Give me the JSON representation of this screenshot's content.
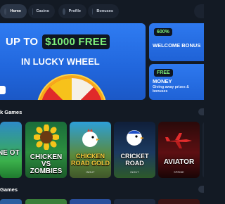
{
  "nav": {
    "items": [
      {
        "label": "Home",
        "icon": "home-icon",
        "active": true
      },
      {
        "label": "Casino",
        "icon": "casino-chip-icon",
        "active": false
      },
      {
        "label": "Profile",
        "icon": "profile-icon",
        "active": false
      },
      {
        "label": "Bonuses",
        "icon": "gift-icon",
        "active": false
      }
    ]
  },
  "hero": {
    "line1_prefix": "UP TO",
    "amount": "$1000 FREE",
    "line2": "IN LUCKY WHEEL"
  },
  "promos": {
    "welcome": {
      "badge": "600%",
      "title": "WELCOME BONUS"
    },
    "free": {
      "badge": "FREE",
      "title": "MONEY",
      "subtitle": "Giving away prizes & bonuses"
    }
  },
  "sections": {
    "first": "k Games",
    "second": "Games"
  },
  "games": [
    {
      "title": "NE OT",
      "sub": ""
    },
    {
      "title": "CHICKEN VS ZOMBIES",
      "sub": "INOUT"
    },
    {
      "title": "CHICKEN ROAD GOLD",
      "sub": "INOUT"
    },
    {
      "title": "CRICKET ROAD",
      "sub": "INOUT"
    },
    {
      "title": "AVIATOR",
      "sub": "SPRIBE"
    }
  ],
  "colors": {
    "background": "#131a24",
    "brand_blue": "#2a72ea",
    "accent_green": "#7ef07a",
    "badge_dark": "#0f1621"
  }
}
